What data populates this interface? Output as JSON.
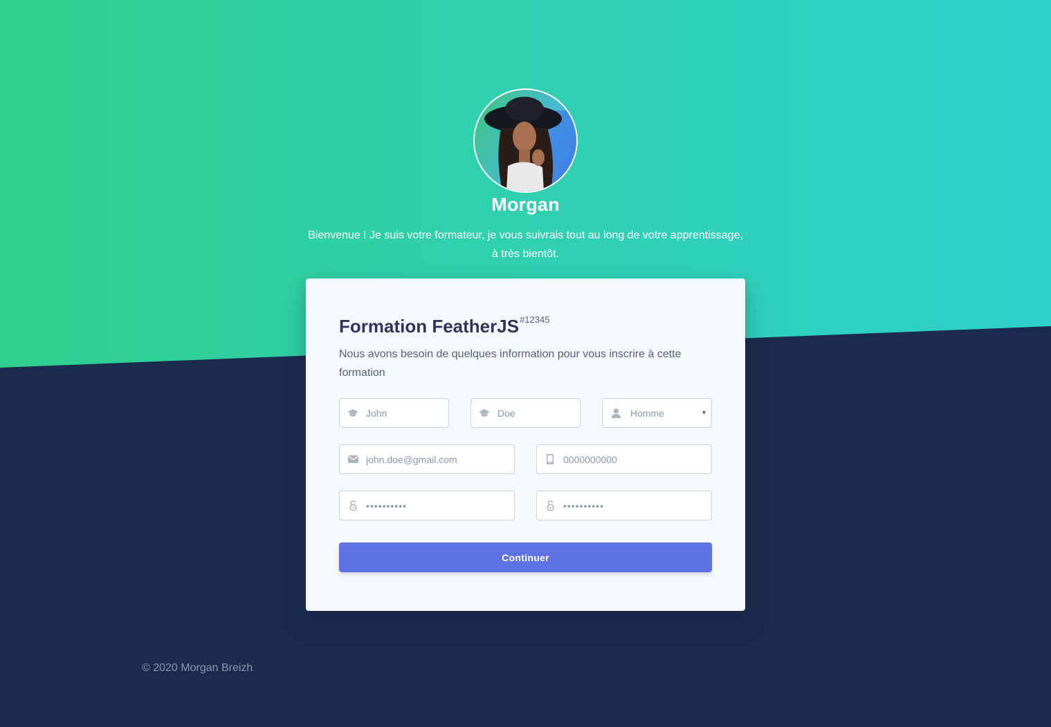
{
  "header": {
    "avatar_alt": "Morgan",
    "name": "Morgan",
    "welcome_line1": "Bienvenue ! Je suis votre formateur, je vous suivrais tout au long de votre apprentissage,",
    "welcome_line2": "à très bientôt."
  },
  "form": {
    "title": "Formation FeatherJS",
    "course_id": "#12345",
    "description": "Nous avons besoin de quelques information pour vous inscrire à cette formation",
    "first_name": {
      "placeholder": "John",
      "icon": "graduation-cap-icon"
    },
    "last_name": {
      "placeholder": "Doe",
      "icon": "graduation-cap-icon"
    },
    "gender": {
      "value": "Homme",
      "icon": "user-icon"
    },
    "email": {
      "placeholder": "john.doe@gmail.com",
      "icon": "envelope-icon"
    },
    "phone": {
      "placeholder": "0000000000",
      "icon": "mobile-icon"
    },
    "password": {
      "value": "••••••••••",
      "icon": "unlock-icon"
    },
    "password_confirm": {
      "value": "••••••••••",
      "icon": "unlock-icon"
    },
    "submit_label": "Continuer"
  },
  "footer": {
    "copyright": "© 2020 Morgan Breizh"
  },
  "colors": {
    "gradient_start": "#2fcf8e",
    "gradient_end": "#2ed0cb",
    "navy": "#1b2b4f",
    "primary_button": "#5e72e4",
    "card_bg": "#f6f9fc"
  }
}
